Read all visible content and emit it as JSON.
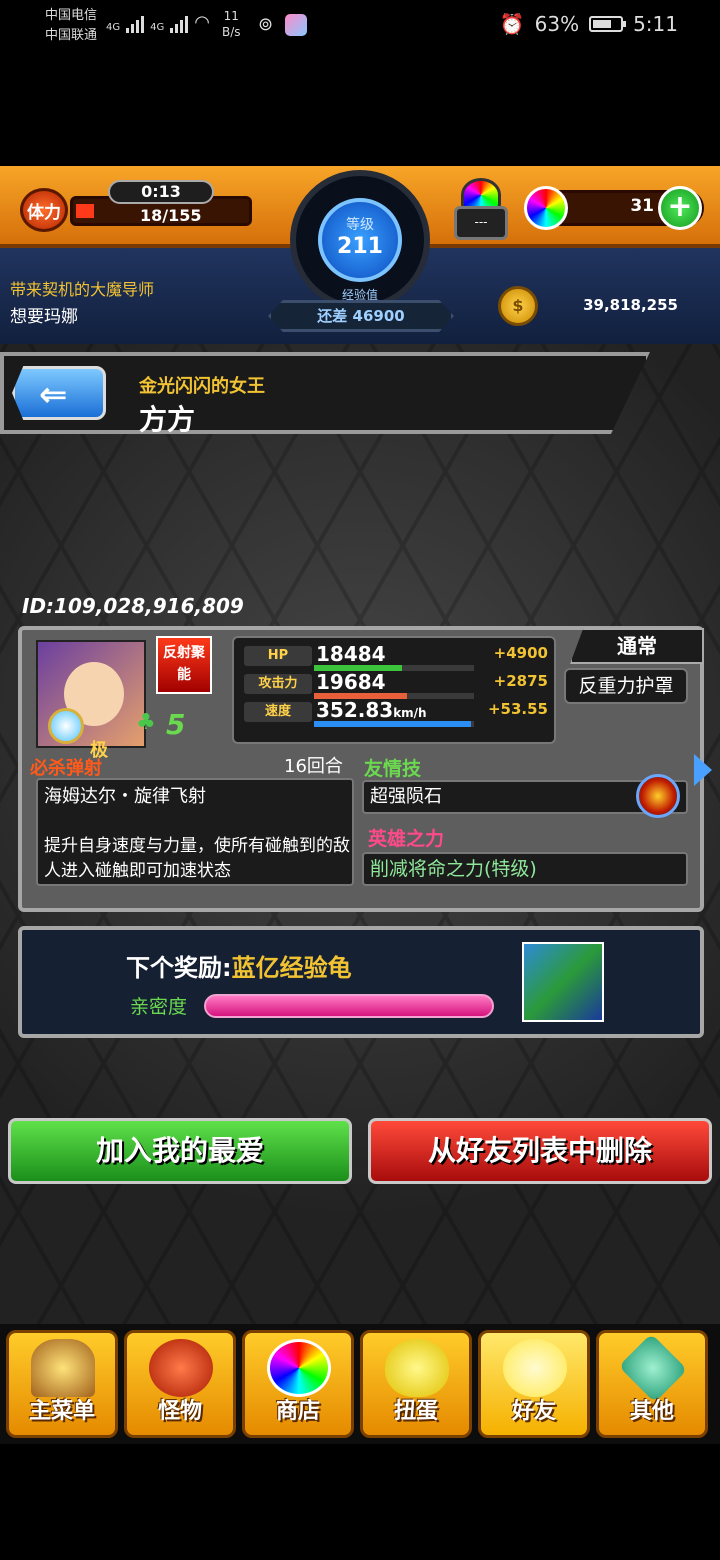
{
  "status_bar": {
    "carrier1": "中国电信",
    "carrier2": "中国联通",
    "net1": "4G",
    "net2": "4G",
    "speed_value": "11",
    "speed_unit": "B/s",
    "battery": "63%",
    "time": "5:11"
  },
  "header": {
    "stamina_label": "体力",
    "stamina_timer": "0:13",
    "stamina_value": "18/155",
    "level_label": "等级",
    "level": "211",
    "exp_label": "经验值",
    "exp_remaining": "还差 46900",
    "lock_text": "---",
    "orbs": "31",
    "plus": "+",
    "player_title": "带来契机的大魔导师",
    "player_name": "想要玛娜",
    "coin_symbol": "$",
    "gold": "39,818,255"
  },
  "banner": {
    "subtitle": "金光闪闪的女王",
    "title": "方方",
    "back_arrow": "⇐"
  },
  "monster": {
    "user_id": "ID:109,028,916,809",
    "ability_icon": "反射聚能",
    "rank": "极",
    "luck": "5",
    "clover": "♣",
    "stats": [
      {
        "label": "HP",
        "value": "18484",
        "plus": "+4900",
        "bar_color": "#3cc53c",
        "fill": 0.55
      },
      {
        "label": "攻击力",
        "value": "19684",
        "plus": "+2875",
        "bar_color": "#e8603a",
        "fill": 0.58
      },
      {
        "label": "速度",
        "value": "352.83",
        "unit": "km/h",
        "plus": "+53.55",
        "bar_color": "#2a8ef5",
        "fill": 0.98
      }
    ],
    "type": "通常",
    "type_ability": "反重力护罩",
    "strike_shot_label": "必杀弹射",
    "turns": "16回合",
    "strike_shot_name": "海姆达尔・旋律飞射",
    "strike_shot_desc": "提升自身速度与力量，使所有碰触到的敌人进入碰触即可加速状态",
    "friendship_label": "友情技",
    "friendship": "超强陨石",
    "hero_label": "英雄之力",
    "hero": "削减将命之力(特级)"
  },
  "reward": {
    "prefix": "下个奖励:",
    "item": "蓝亿经验龟",
    "intimacy_label": "亲密度",
    "intimacy_fill": 1.0
  },
  "buttons": {
    "favorite": "加入我的最爱",
    "remove": "从好友列表中删除"
  },
  "nav": [
    {
      "label": "主菜单",
      "icon": "home-icon"
    },
    {
      "label": "怪物",
      "icon": "monster-icon"
    },
    {
      "label": "商店",
      "icon": "orb-icon"
    },
    {
      "label": "扭蛋",
      "icon": "egg-icon"
    },
    {
      "label": "好友",
      "icon": "friends-icon"
    },
    {
      "label": "其他",
      "icon": "other-icon"
    }
  ]
}
